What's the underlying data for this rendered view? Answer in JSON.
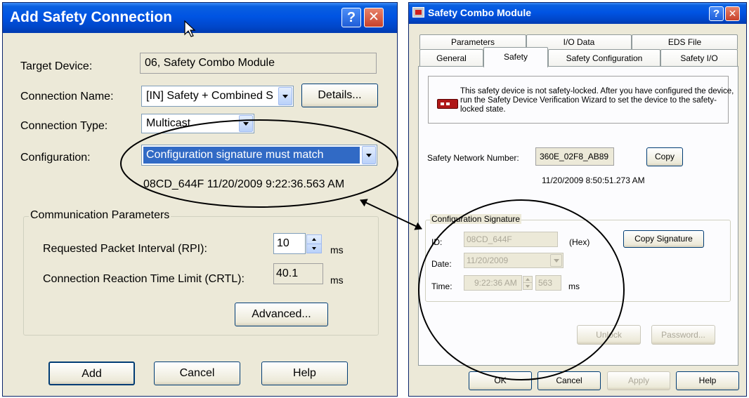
{
  "add_dialog": {
    "title": "Add Safety Connection",
    "target_device_label": "Target Device:",
    "target_device_value": "06, Safety Combo Module",
    "connection_name_label": "Connection Name:",
    "connection_name_value": "[IN] Safety + Combined S",
    "details_label": "Details...",
    "connection_type_label": "Connection Type:",
    "connection_type_value": "Multicast",
    "configuration_label": "Configuration:",
    "configuration_value": "Configuration signature must match",
    "signature_text": "08CD_644F 11/20/2009 9:22:36.563 AM",
    "comm_group_title": "Communication Parameters",
    "rpi_label": "Requested Packet Interval (RPI):",
    "rpi_value": "10",
    "rpi_unit": "ms",
    "crtl_label": "Connection Reaction Time Limit (CRTL):",
    "crtl_value": "40.1",
    "crtl_unit": "ms",
    "advanced_label": "Advanced...",
    "add_label": "Add",
    "cancel_label": "Cancel",
    "help_label": "Help",
    "help_glyph": "?",
    "close_glyph": "✕"
  },
  "module_dialog": {
    "title": "Safety Combo Module",
    "help_glyph": "?",
    "close_glyph": "✕",
    "tabs_back": [
      "Parameters",
      "I/O Data",
      "EDS File"
    ],
    "tabs_front": [
      "General",
      "Safety",
      "Safety Configuration",
      "Safety I/O"
    ],
    "active_tab": "Safety",
    "info_text": "This safety device is not safety-locked. After you have configured the device, run the Safety Device Verification Wizard to set the device to the safety-locked state.",
    "snn_label": "Safety Network Number:",
    "snn_value": "360E_02F8_AB89",
    "copy_label": "Copy",
    "snn_timestamp": "11/20/2009 8:50:51.273 AM",
    "config_sig_title": "Configuration Signature",
    "id_label": "ID:",
    "id_value": "08CD_644F",
    "hex_label": "(Hex)",
    "copy_signature_label": "Copy Signature",
    "date_label": "Date:",
    "date_value": "11/20/2009",
    "time_label": "Time:",
    "time_value": "9:22:36 AM",
    "ms_value": "563",
    "ms_unit": "ms",
    "unlock_label": "Unlock",
    "password_label": "Password...",
    "ok_label": "OK",
    "cancel_label": "Cancel",
    "apply_label": "Apply",
    "help_label": "Help"
  },
  "colors": {
    "titlebar": "#0054e3",
    "dialog_face": "#ece9d8",
    "selection": "#316ac5",
    "annotation": "#000000"
  }
}
